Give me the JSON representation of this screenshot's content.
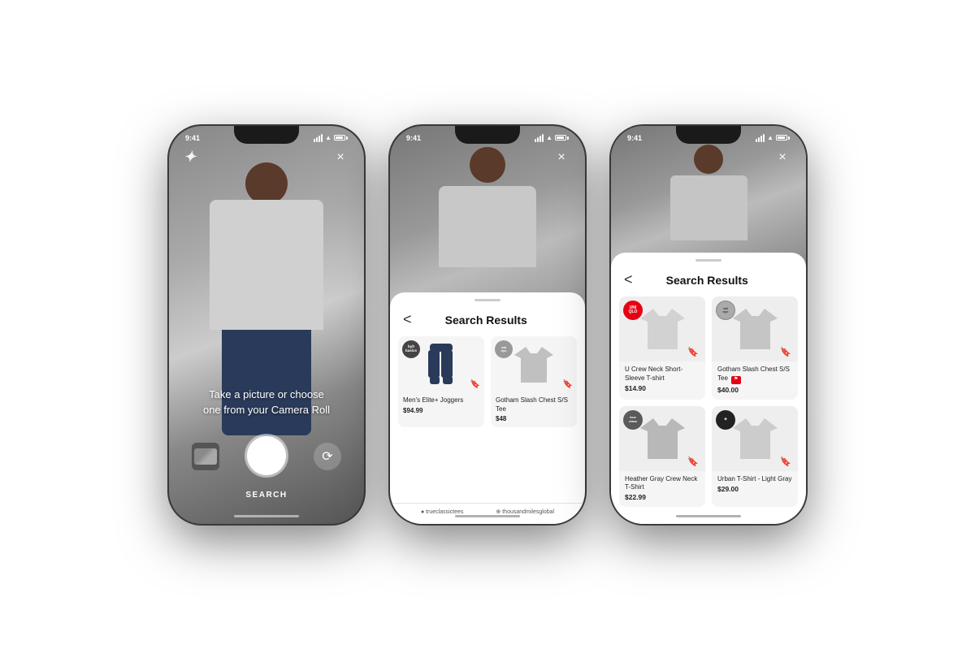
{
  "page": {
    "background": "#ffffff"
  },
  "phones": [
    {
      "id": "phone1",
      "type": "camera",
      "status_bar": {
        "time": "9:41",
        "signal": true,
        "wifi": true,
        "battery": true
      },
      "logo": "//",
      "close_label": "×",
      "instruction": "Take a picture or choose one from your Camera Roll",
      "search_label": "SEARCH"
    },
    {
      "id": "phone2",
      "type": "search_results_partial",
      "status_bar": {
        "time": "9:41",
        "signal": true,
        "wifi": true,
        "battery": true
      },
      "close_label": "×",
      "sheet": {
        "title": "Search Results",
        "back_label": "<",
        "products": [
          {
            "brand": "bylt\nbasics",
            "brand_color": "#333",
            "brand_style": "dark",
            "name": "Men's Elite+ Joggers",
            "price": "$94.99",
            "type": "joggers",
            "img_bg": "#2a3a5a"
          },
          {
            "brand": "saturdaysnyc",
            "brand_color": "#aaa",
            "brand_style": "gray",
            "name": "Gotham Slash Chest S/S Tee",
            "price": "$48",
            "type": "tshirt",
            "img_bg": "#c8c8c8"
          }
        ]
      }
    },
    {
      "id": "phone3",
      "type": "search_results_full",
      "status_bar": {
        "time": "9:41",
        "signal": true,
        "wifi": true,
        "battery": true
      },
      "close_label": "×",
      "sheet": {
        "title": "Search Results",
        "back_label": "<",
        "products": [
          {
            "brand": "UNI\nQLO",
            "brand_key": "uniqlo",
            "name": "U Crew Neck Short-Sleeve T-shirt",
            "price": "$14.90",
            "type": "tshirt",
            "color": "#d5d5d5"
          },
          {
            "brand": "saturdaysnyc",
            "brand_key": "saturday",
            "name": "Gotham Slash Chest S/S Tee",
            "price": "$40.00",
            "sale": "⚑",
            "type": "tshirt",
            "color": "#c8c8c8"
          },
          {
            "brand": "trueclassictees",
            "brand_key": "trueclassic",
            "name": "Heather Gray Crew Neck T-Shirt",
            "price": "$22.99",
            "type": "tshirt",
            "color": "#bbbbbb"
          },
          {
            "brand": "thousandmilesglobal",
            "brand_key": "thousand",
            "name": "Urban T-Shirt - Light Gray",
            "price": "$29.00",
            "type": "tshirt",
            "color": "#cccccc"
          }
        ]
      }
    }
  ]
}
